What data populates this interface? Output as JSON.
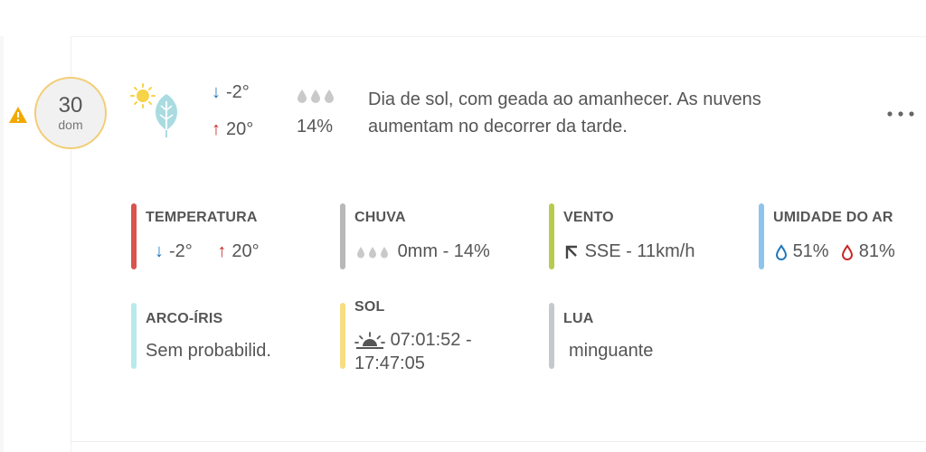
{
  "day": {
    "number": "30",
    "weekday": "dom"
  },
  "forecast": {
    "temp_min": "-2°",
    "temp_max": "20°",
    "rain_probability": "14%",
    "summary": "Dia de sol, com geada ao amanhecer. As nuvens aumentam no decorrer da tarde."
  },
  "details": {
    "temperature": {
      "label": "TEMPERATURA",
      "min": "-2°",
      "max": "20°"
    },
    "rain": {
      "label": "CHUVA",
      "value": "0mm - 14%"
    },
    "wind": {
      "label": "VENTO",
      "value": "SSE - 11km/h"
    },
    "humidity": {
      "label": "UMIDADE DO AR",
      "min": "51%",
      "max": "81%"
    },
    "rainbow": {
      "label": "ARCO-ÍRIS",
      "value": "Sem probabilid."
    },
    "sun": {
      "label": "SOL",
      "line1": "07:01:52 -",
      "line2": "17:47:05"
    },
    "moon": {
      "label": "LUA",
      "value": "minguante"
    }
  },
  "colors": {
    "temperature_bar": "#d9534f",
    "rain_bar": "#b8b8b8",
    "wind_bar": "#b5cc4f",
    "humidity_bar": "#8ec4ec",
    "rainbow_bar": "#b8eaea",
    "sun_bar": "#f6dd82",
    "moon_bar": "#c3c9cc",
    "arrow_down": "#2277bb",
    "arrow_up": "#c62828",
    "day_circle_border": "#f2cd74",
    "warning": "#f2a900"
  },
  "icons": [
    "warning-icon",
    "sun-icon",
    "frost-leaf-icon",
    "arrow-down-icon",
    "arrow-up-icon",
    "rain-drops-icon",
    "more-icon",
    "wind-direction-icon",
    "humidity-drop-icon",
    "sunrise-icon"
  ]
}
